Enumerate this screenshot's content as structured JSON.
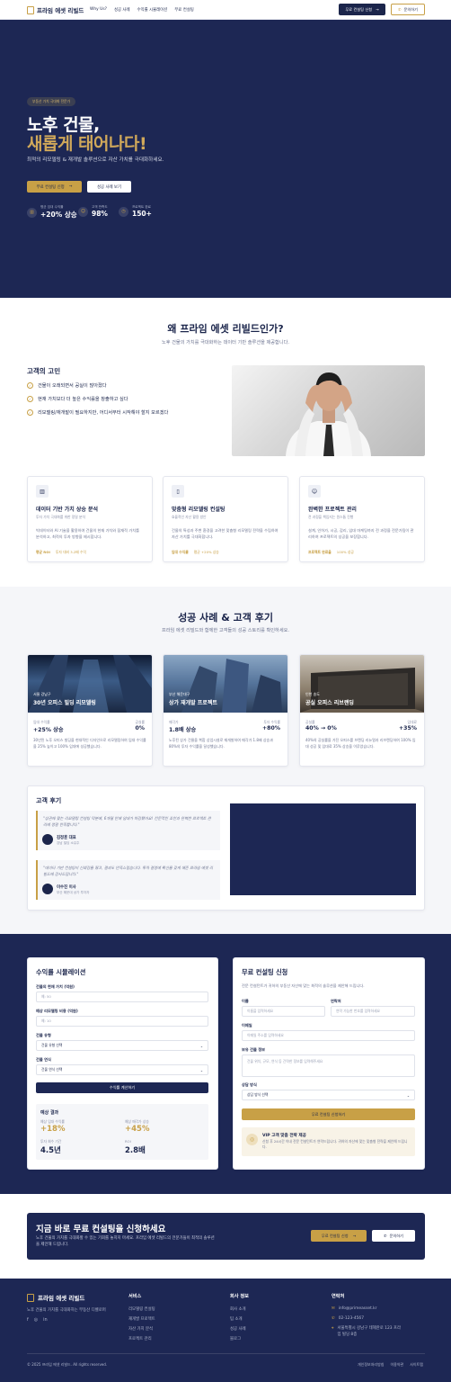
{
  "nav": {
    "brand": "프라임 에셋 리빌드",
    "links": [
      "Why Us?",
      "성공 사례",
      "수익률 시뮬레이션",
      "무료 컨설팅"
    ],
    "cta_primary": "무료 컨설팅 신청",
    "cta_secondary": "문의하기"
  },
  "hero": {
    "badge": "부동산 가치 극대화 전문가",
    "title_line1": "노후 건물,",
    "title_line2": "새롭게 태어나다!",
    "subtitle": "최적의 리모델링 & 재개발 솔루션으로 자산 가치를 극대화하세요.",
    "btn_primary": "무료 컨설팅 신청",
    "btn_secondary": "성공 사례 보기",
    "stats": [
      {
        "label": "평균 임대 수익률",
        "value": "+20% 상승"
      },
      {
        "label": "고객 만족도",
        "value": "98%"
      },
      {
        "label": "프로젝트 완료",
        "value": "150+"
      }
    ]
  },
  "why": {
    "title": "왜 프라임 에셋 리빌드인가?",
    "subtitle": "노후 건물의 가치를 극대화하는 데이터 기반 솔루션을 제공합니다.",
    "pain_title": "고객의 고민",
    "pains": [
      "건물이 오래되면서 공실이 많아졌다",
      "현재 가치보다 더 높은 수익률을 창출하고 싶다",
      "리모델링/재개발이 필요하지만, 어디서부터 시작해야 할지 모르겠다"
    ],
    "services": [
      {
        "title": "데이터 기반 가치 상승 분석",
        "sub": "투자 가치 극대화를 위한 정밀 분석",
        "desc": "빅데이터와 AI 기술을 활용하여 건물의 현재 가치와 잠재적 가치를 분석하고, 최적의 투자 방향을 제시합니다.",
        "foot1": "평균 ROI",
        "foot2": "투자 대비 3.2배 수익"
      },
      {
        "title": "맞춤형 리모델링 컨설팅",
        "sub": "효율적인 자산 활용 방안",
        "desc": "건물의 특성과 주변 환경을 고려한 맞춤형 리모델링 전략을 수립하여 자산 가치를 극대화합니다.",
        "foot1": "임대 수익률",
        "foot2": "평균 +20% 상승"
      },
      {
        "title": "완벽한 프로젝트 관리",
        "sub": "전 과정을 책임지는 원스톱 진행",
        "desc": "설계, 인허가, 시공, 감리, 임대 마케팅까지 전 과정을 전문가팀이 관리하여 프로젝트의 성공을 보장합니다.",
        "foot1": "프로젝트 완료율",
        "foot2": "100% 성공"
      }
    ]
  },
  "cases": {
    "title": "성공 사례 & 고객 후기",
    "subtitle": "프라임 에셋 리빌드와 함께한 고객들의 성공 스토리를 확인하세요.",
    "items": [
      {
        "loc": "서울 강남구",
        "title": "30년 오피스 빌딩 리모델링",
        "m1_label": "임대 수익률",
        "m1_value": "+25% 상승",
        "m2_label": "공실률",
        "m2_value": "0%",
        "desc": "30년된 노후 오피스 빌딩을 현대적인 디자인으로 리모델링하여 임대 수익률을 25% 높이고 100% 임대에 성공했습니다."
      },
      {
        "loc": "부산 해운대구",
        "title": "상가 재개발 프로젝트",
        "m1_label": "매각가",
        "m1_value": "1.8배 상승",
        "m2_label": "투자 수익률",
        "m2_value": "+80%",
        "desc": "노후된 상가 건물을 복합 상업시설로 재개발하여 매각가 1.8배 상승과 80%의 투자 수익률을 달성했습니다."
      },
      {
        "loc": "인천 송도",
        "title": "공실 오피스 리브랜딩",
        "m1_label": "공실률",
        "m1_value": "40% → 0%",
        "m2_label": "임대료",
        "m2_value": "+35%",
        "desc": "40%의 공실률을 가진 오피스를 브랜딩 리뉴얼과 리브랜딩하여 100% 임대 성공 및 임대료 35% 상승을 이루었습니다."
      }
    ],
    "review_title": "고객 후기",
    "reviews": [
      {
        "quote": "\"상권에 맞는 리모델링 컨설팅 덕분에, 6개월 만에 임대가 마감됐어요! 전문적인 조언과 완벽한 프로젝트 관리에 정말 만족합니다.\"",
        "name": "김정훈 대표",
        "role": "강남 빌딩 소유주"
      },
      {
        "quote": "\"데이터 기반 컨설팅이 신뢰감을 줬고, 결과도 만족스럽습니다. 투자 결정에 확신을 갖게 해준 프라임 에셋 리빌드에 감사드립니다.\"",
        "name": "이수진 이사",
        "role": "부산 해운대 상가 투자자"
      }
    ]
  },
  "sim": {
    "title": "수익률 시뮬레이션",
    "f1_label": "건물의 현재 가치 (억원)",
    "f1_ph": "예: 50",
    "f2_label": "예상 리모델링 비용 (억원)",
    "f2_ph": "예: 10",
    "f3_label": "건물 유형",
    "f3_val": "건물 유형 선택",
    "f4_label": "건물 연식",
    "f4_val": "건물 연식 선택",
    "btn": "수익률 계산하기",
    "res_title": "예상 결과",
    "r1_label": "예상 임대 수익률",
    "r1_value": "+18%",
    "r2_label": "예상 매각가 상승",
    "r2_value": "+45%",
    "r3_label": "투자 회수 기간",
    "r3_value": "4.5년",
    "r4_label": "ROI",
    "r4_value": "2.8배"
  },
  "consult": {
    "title": "무료 컨설팅 신청",
    "subtitle": "전문 컨설턴트가 귀하의 부동산 자산에 맞는 최적의 솔루션을 제안해 드립니다.",
    "name_label": "이름",
    "name_ph": "이름을 입력하세요",
    "phone_label": "연락처",
    "phone_ph": "연락 가능한 번호를 입력하세요",
    "email_label": "이메일",
    "email_ph": "이메일 주소를 입력하세요",
    "bld_label": "보유 건물 정보",
    "bld_ph": "건물 위치, 규모, 연식 등 간략한 정보를 입력해주세요",
    "method_label": "상담 방식",
    "method_val": "상담 방식 선택",
    "btn": "무료 컨설팅 신청하기",
    "vip_title": "VIP 고객 맞춤 전략 제공",
    "vip_desc": "신청 후 24시간 이내 전문 컨설턴트가 연락드립니다. 귀하의 자산에 맞는 맞춤형 전략을 제안해 드립니다."
  },
  "cta": {
    "title": "지금 바로 무료 컨설팅을 신청하세요",
    "desc": "노후 건물의 가치를 극대화할 수 있는 기회를 놓치지 마세요. 프라임 에셋 리빌드의 전문가들이 최적의 솔루션을 제안해 드립니다.",
    "btn1": "무료 컨설팅 신청",
    "btn2": "문의하기"
  },
  "footer": {
    "brand": "프라임 에셋 리빌드",
    "tagline": "노후 건물의 가치를 극대화하는 부동산 디벨로퍼",
    "col1_title": "서비스",
    "col1": [
      "리모델링 컨설팅",
      "재개발 프로젝트",
      "자산 가치 분석",
      "프로젝트 관리"
    ],
    "col2_title": "회사 정보",
    "col2": [
      "회사 소개",
      "팀 소개",
      "성공 사례",
      "블로그"
    ],
    "col3_title": "연락처",
    "email": "info@primeasset.kr",
    "phone": "02-123-4567",
    "addr": "서울특별시 강남구 테헤란로 123 프라임 빌딩 8층",
    "copyright": "© 2025 프라임 에셋 리빌드. All rights reserved.",
    "legal": [
      "개인정보처리방침",
      "이용약관",
      "사이트맵"
    ]
  },
  "colors": {
    "navy": "#1d2754",
    "gold": "#c8a046"
  }
}
